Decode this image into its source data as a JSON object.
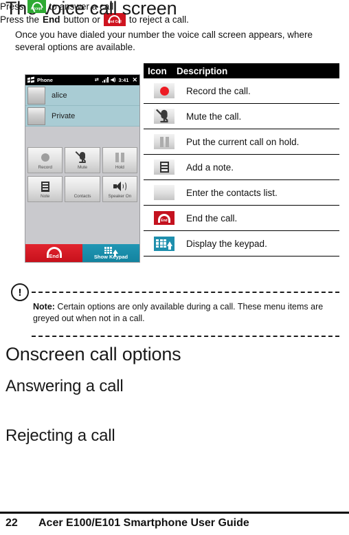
{
  "document": {
    "section_title": "The voice call screen",
    "intro_paragraph": "Once you have dialed your number the voice call screen appears, where several options are available."
  },
  "phone_screenshot": {
    "titlebar": {
      "app_name": "Phone",
      "logo_icon": "windows-logo-icon",
      "connectivity_icon": "data-connection-icon",
      "signal_icon": "signal-bars-icon",
      "volume_icon": "speaker-icon",
      "time": "3:41",
      "close_icon": "close-x-icon"
    },
    "contacts": [
      {
        "name": "alice",
        "avatar_icon": "contact-avatar-icon"
      },
      {
        "name": "Private",
        "avatar_icon": "contact-avatar-icon"
      }
    ],
    "buttons": [
      {
        "label": "Record",
        "icon": "record-dot-icon"
      },
      {
        "label": "Mute",
        "icon": "mute-microphone-icon"
      },
      {
        "label": "Hold",
        "icon": "pause-icon"
      },
      {
        "label": "Note",
        "icon": "note-lines-icon"
      },
      {
        "label": "Contacts",
        "icon": "contacts-person-icon"
      },
      {
        "label": "Speaker On",
        "icon": "speaker-on-icon"
      }
    ],
    "bottom_bar": {
      "end_label": "End",
      "end_icon": "end-call-handset-icon",
      "end_color": "#c8101b",
      "keypad_label": "Show Keypad",
      "keypad_icon": "keypad-grid-up-icon",
      "keypad_color": "#13839f"
    },
    "colors": {
      "contact_row": "#a9ccd4",
      "body": "#c9c9cd",
      "titlebar": "#000000"
    }
  },
  "icon_table": {
    "headers": {
      "icon": "Icon",
      "description": "Description"
    },
    "rows": [
      {
        "icon": "record-dot-icon",
        "description": "Record the call."
      },
      {
        "icon": "mute-microphone-icon",
        "description": "Mute the call."
      },
      {
        "icon": "pause-hold-icon",
        "description": "Put the current call on hold."
      },
      {
        "icon": "note-lines-icon",
        "description": "Add a note."
      },
      {
        "icon": "contacts-person-icon",
        "description": "Enter the contacts list."
      },
      {
        "icon": "end-call-icon",
        "description": "End the call."
      },
      {
        "icon": "keypad-grid-icon",
        "description": "Display the keypad."
      }
    ],
    "end_tile_label": "End",
    "colors": {
      "record": "#ed1c24",
      "end_tile": "#c4121f",
      "keypad_tile": "#1e8fad"
    }
  },
  "note_block": {
    "warning_icon": "exclamation-circle-icon",
    "label": "Note:",
    "text": " Certain options are only available during a call. These menu items are greyed out when not in a call."
  },
  "onscreen_section": {
    "title": "Onscreen call options",
    "answering": {
      "title": "Answering a call",
      "text_before": "Press",
      "icon": "accept-call-icon",
      "icon_label": "Accept",
      "text_after": "to answer a call."
    },
    "rejecting": {
      "title": "Rejecting a call",
      "text_before": "Press the",
      "bold_word": "End",
      "text_middle": "button or",
      "icon": "end-call-icon",
      "icon_label": "End Call",
      "text_after": "to reject a call."
    }
  },
  "footer": {
    "page_number": "22",
    "title": "Acer E100/E101 Smartphone User Guide"
  }
}
